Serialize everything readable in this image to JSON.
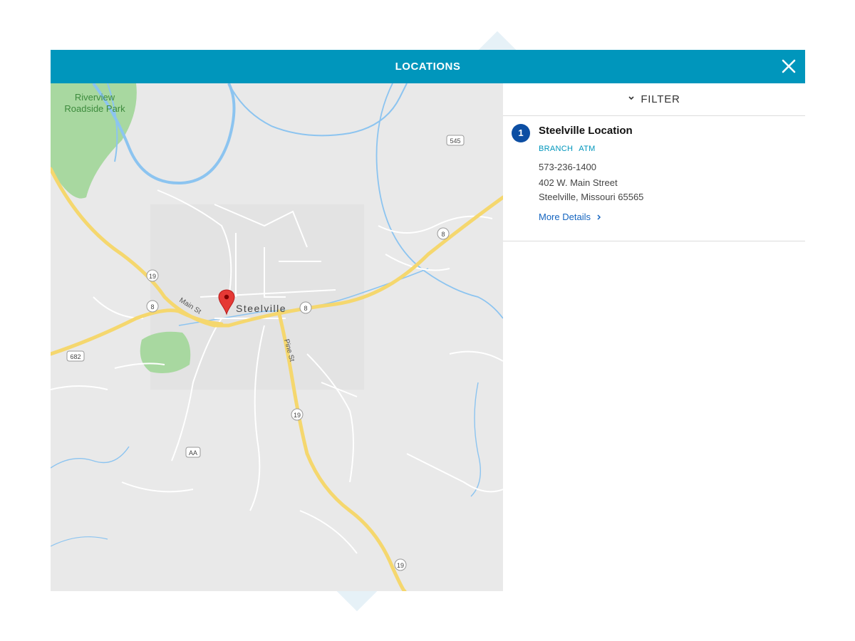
{
  "modal": {
    "title": "LOCATIONS",
    "close_icon": "close-icon"
  },
  "map": {
    "park_label_line1": "Riverview",
    "park_label_line2": "Roadside Park",
    "town_label": "Steelville",
    "street_main": "Main St",
    "street_pine": "Pine St",
    "route_shields": [
      "545",
      "8",
      "19",
      "8",
      "8",
      "682",
      "19",
      "AA",
      "19"
    ],
    "marker_icon": "map-pin-icon",
    "colors": {
      "land": "#e9e9e9",
      "road_major": "#f5d76e",
      "road_minor": "#ffffff",
      "water": "#8cc4f0",
      "park": "#a8d8a0",
      "marker": "#e53935"
    }
  },
  "panel": {
    "filter_label": "FILTER",
    "filter_icon": "chevron-down-icon",
    "results": [
      {
        "number": "1",
        "name": "Steelville Location",
        "tags": [
          "BRANCH",
          "ATM"
        ],
        "phone": "573-236-1400",
        "address_line1": "402 W. Main Street",
        "address_line2": "Steelville, Missouri 65565",
        "details_label": "More Details",
        "details_icon": "chevron-right-icon"
      }
    ]
  },
  "colors": {
    "header_bg": "#0096bc",
    "badge_bg": "#0c4ea3",
    "tag_text": "#0096bc",
    "link_text": "#1565c0"
  }
}
